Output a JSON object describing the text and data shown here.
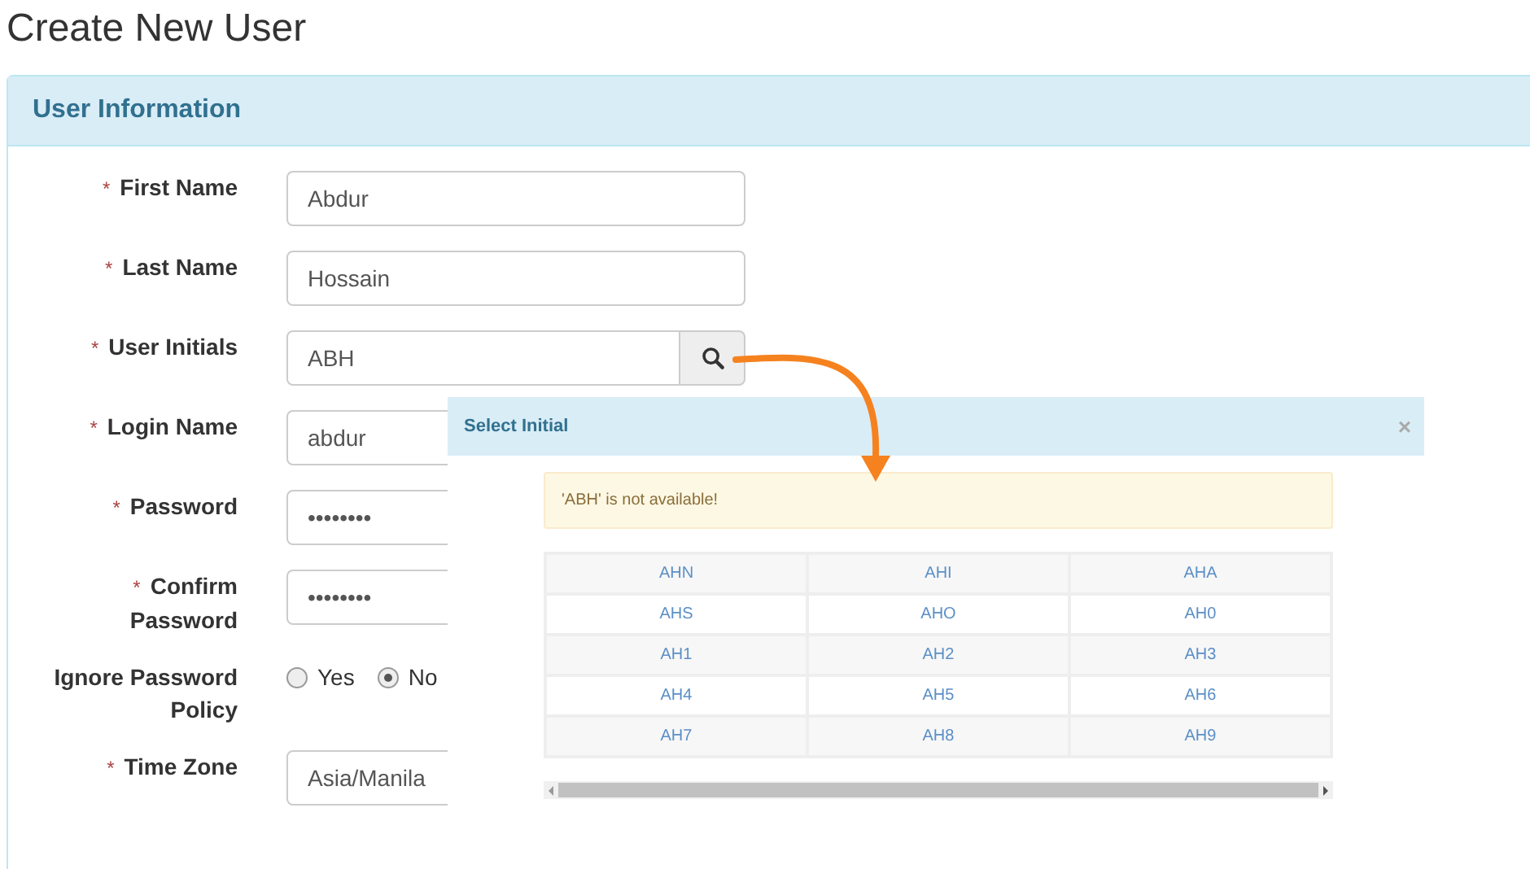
{
  "page_title": "Create New User",
  "panel": {
    "title": "User Information",
    "fields": [
      {
        "kind": "text",
        "marker": "*",
        "label": "First Name",
        "value": "Abdur"
      },
      {
        "kind": "text",
        "marker": "*",
        "label": "Last Name",
        "value": "Hossain"
      },
      {
        "kind": "search",
        "marker": "*",
        "label": "User Initials",
        "value": "ABH"
      },
      {
        "kind": "text",
        "marker": "*",
        "label": "Login Name",
        "value": "abdur"
      },
      {
        "kind": "text",
        "marker": "*",
        "label": "Password",
        "value": "••••••••"
      },
      {
        "kind": "text",
        "marker": "*",
        "label": "Confirm Password",
        "value": "••••••••"
      },
      {
        "kind": "radio",
        "label": "Ignore Password Policy",
        "options": [
          {
            "label": "Yes",
            "selected": false
          },
          {
            "label": "No",
            "selected": true
          }
        ]
      },
      {
        "kind": "select",
        "marker": "*",
        "label": "Time Zone",
        "value": "Asia/Manila"
      }
    ]
  },
  "dialog": {
    "title": "Select Initial",
    "close": "×",
    "alert": "'ABH' is not available!",
    "rows": [
      [
        "AHN",
        "AHI",
        "AHA"
      ],
      [
        "AHS",
        "AHO",
        "AH0"
      ],
      [
        "AH1",
        "AH2",
        "AH3"
      ],
      [
        "AH4",
        "AH5",
        "AH6"
      ],
      [
        "AH7",
        "AH8",
        "AH9"
      ]
    ]
  }
}
